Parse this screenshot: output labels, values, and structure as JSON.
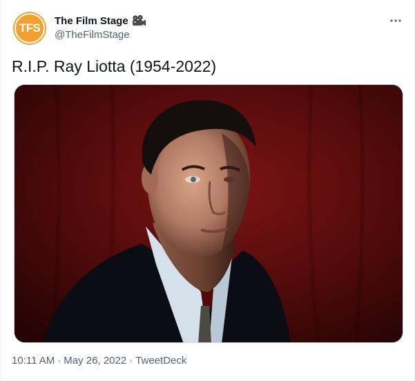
{
  "author": {
    "display_name": "The Film Stage",
    "handle": "@TheFilmStage",
    "avatar_initials": "TFS",
    "avatar_color": "#f29f2e",
    "badge_icon": "movie-camera-icon"
  },
  "tweet": {
    "text": "R.I.P. Ray Liotta (1954-2022)",
    "more_icon": "more-horizontal-icon"
  },
  "meta": {
    "time": "10:11 AM",
    "separator_1": "·",
    "date": "May 26, 2022",
    "separator_2": "·",
    "source": "TweetDeck"
  },
  "colors": {
    "text_primary": "#0f1419",
    "text_secondary": "#536471",
    "border": "#cfd9de"
  }
}
